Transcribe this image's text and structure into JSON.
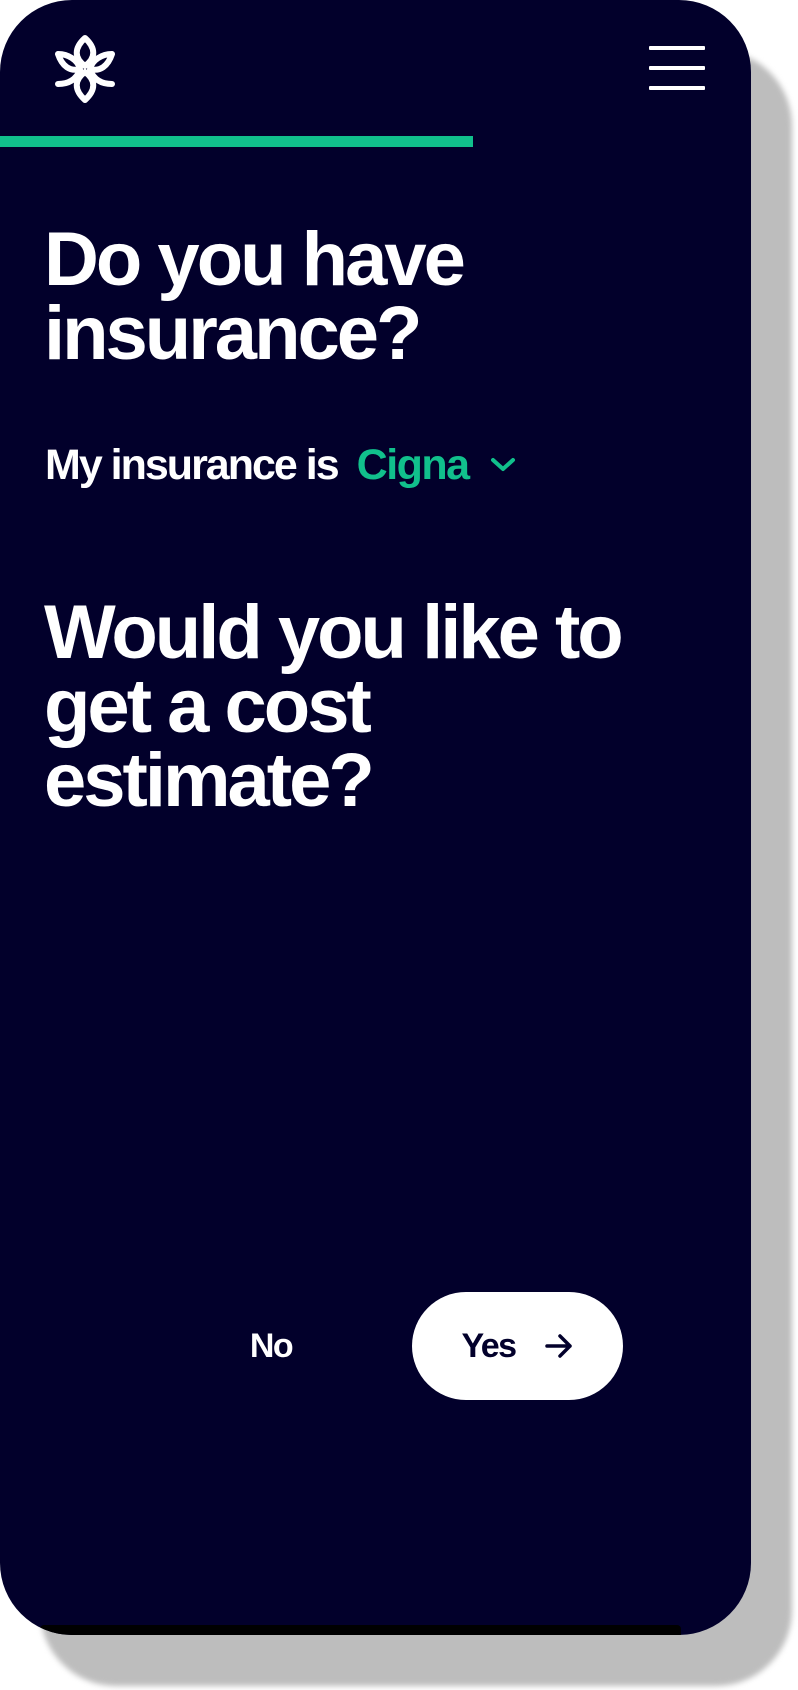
{
  "theme": {
    "background": "#02002b",
    "accent": "#11c08c",
    "text": "#ffffff"
  },
  "header": {
    "logo_icon": "lotus-flower-icon",
    "menu_icon": "hamburger-menu-icon"
  },
  "progress": {
    "fraction": 0.63
  },
  "question_insurance": {
    "heading": "Do you have insurance?",
    "label": "My insurance is",
    "selected_value": "Cigna",
    "dropdown_icon": "chevron-down-icon"
  },
  "question_estimate": {
    "heading": "Would you like to get a cost estimate?"
  },
  "actions": {
    "no_label": "No",
    "yes_label": "Yes",
    "yes_icon": "arrow-right-icon"
  }
}
